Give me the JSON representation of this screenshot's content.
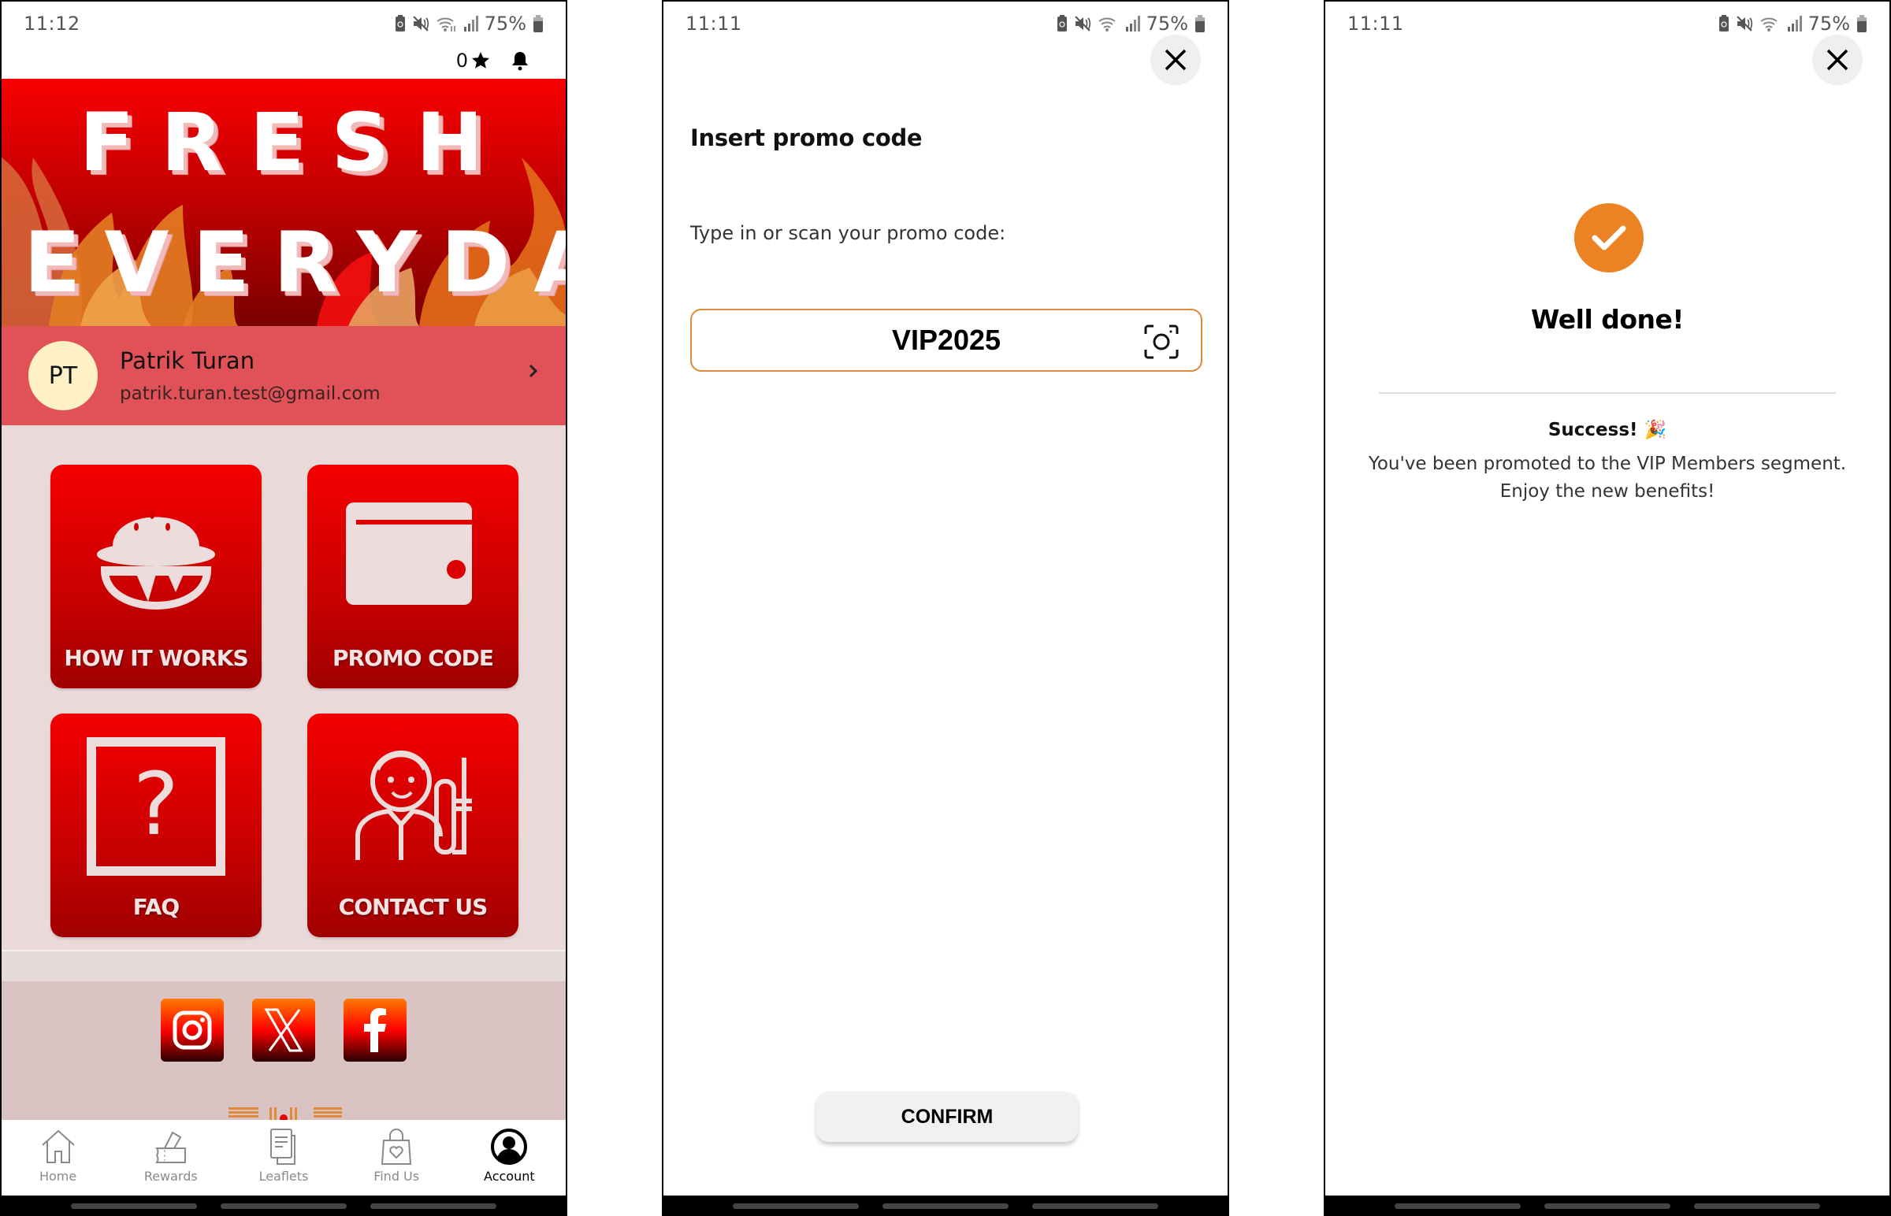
{
  "screens": [
    {
      "status_bar": {
        "time": "11:12",
        "battery": "75%"
      },
      "header": {
        "points": "0",
        "points_icon": "star-icon",
        "notification_icon": "bell-icon"
      },
      "banner": {
        "line1": "FRESH",
        "line2": "EVERYDAY"
      },
      "profile": {
        "initials": "PT",
        "name": "Patrik Turan",
        "email": "patrik.turan.test@gmail.com"
      },
      "tiles": [
        {
          "label": "HOW IT WORKS",
          "icon": "burger-icon"
        },
        {
          "label": "PROMO CODE",
          "icon": "wallet-icon"
        },
        {
          "label": "FAQ",
          "icon": "question-icon"
        },
        {
          "label": "CONTACT US",
          "icon": "support-agent-icon"
        }
      ],
      "social": [
        "instagram",
        "x",
        "facebook"
      ],
      "tabbar": [
        {
          "label": "Home",
          "icon": "home-icon",
          "active": false
        },
        {
          "label": "Rewards",
          "icon": "ticket-icon",
          "active": false
        },
        {
          "label": "Leaflets",
          "icon": "document-icon",
          "active": false
        },
        {
          "label": "Find Us",
          "icon": "shopping-bag-icon",
          "active": false
        },
        {
          "label": "Account",
          "icon": "account-icon",
          "active": true
        }
      ]
    },
    {
      "status_bar": {
        "time": "11:11",
        "battery": "75%"
      },
      "title": "Insert promo code",
      "subtitle": "Type in or scan your promo code:",
      "promo_input": {
        "value": "VIP2025",
        "placeholder": ""
      },
      "confirm_label": "CONFIRM"
    },
    {
      "status_bar": {
        "time": "11:11",
        "battery": "75%"
      },
      "heading": "Well done!",
      "success_title": "Success! 🎉",
      "success_body_1": "You've been promoted to the VIP Members segment.",
      "success_body_2": "Enjoy the new benefits!"
    }
  ],
  "colors": {
    "brand_red": "#e00000",
    "profile_bg": "#e05257",
    "tiles_bg": "#e9d9d9",
    "accent_orange": "#ec8223",
    "field_border": "#e0883a"
  }
}
